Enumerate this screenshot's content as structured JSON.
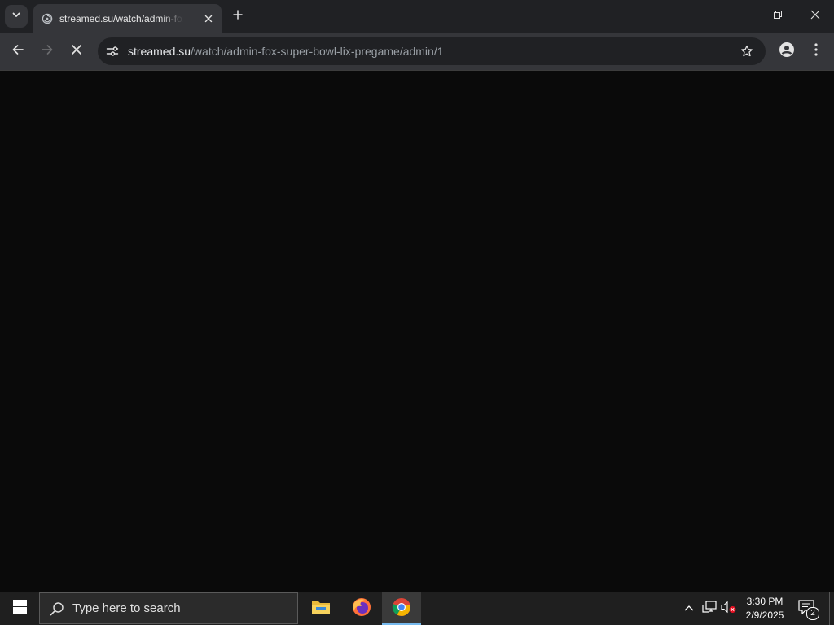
{
  "browser": {
    "tab": {
      "title": "streamed.su/watch/admin-fox-super-bowl-lix-pregame/admin/1",
      "favicon": "globe-icon"
    },
    "toolbar": {
      "url_host": "streamed.su",
      "url_path": "/watch/admin-fox-super-bowl-lix-pregame/admin/1",
      "loading": true
    },
    "colors": {
      "frame": "#202124",
      "toolbar": "#35363a",
      "page": "#0a0a0a"
    }
  },
  "taskbar": {
    "search_placeholder": "Type here to search",
    "apps": [
      "file-explorer-icon",
      "firefox-icon",
      "chrome-icon"
    ],
    "active_app": "chrome-icon",
    "time": "3:30 PM",
    "date": "2/9/2025",
    "notification_count": "2",
    "accent": "#76b9ed"
  }
}
